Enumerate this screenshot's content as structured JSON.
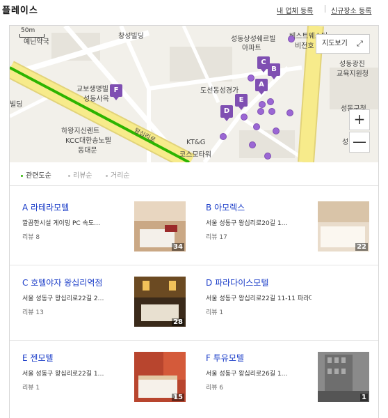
{
  "header": {
    "title": "플레이스",
    "link_register": "내 업체 등록",
    "link_new_place": "신규장소 등록"
  },
  "map": {
    "scale_label": "50m",
    "map_view_label": "지도보기",
    "zoom_in_label": "+",
    "zoom_out_label": "—",
    "road_label": "왕십리로",
    "labels": {
      "yeonlip": "예닌약국",
      "changseong": "창성빌딩",
      "seongdong_apt1": "성동상성쉐르빌",
      "seongdong_apt2": "아파트",
      "bestwestern": "베스트웨스턴",
      "bijeon": "비전호",
      "gyobo1": "교보생명빌",
      "gyobo2": "성동사옥",
      "doseon": "도선동성경가",
      "gwangjin1": "성동광진",
      "gwangjin2": "교육지원청",
      "guchung": "성동구청",
      "building": "빌딩",
      "hawang1": "하왕지신렌트",
      "hawang2": "KCC대한송노텔",
      "dongdaemun": "동대문",
      "ktg1": "KT&G",
      "ktg2": "코스모타워",
      "seong": "성"
    }
  },
  "sort": {
    "relevance": "관련도순",
    "review": "리뷰순",
    "distance": "거리순"
  },
  "places": [
    {
      "marker": "A",
      "name": "라테라모텔",
      "address": "깔끔한시설 게이밍 PC 속도…",
      "review": "리뷰 8",
      "photo_count": "34"
    },
    {
      "marker": "B",
      "name": "아모렉스",
      "address": "서울 성동구 왕십리로20길 1…",
      "review": "리뷰 17",
      "photo_count": "22"
    },
    {
      "marker": "C",
      "name": "호텔야자 왕십리역점",
      "address": "서울 성동구 왕십리로22길 2…",
      "review": "리뷰 13",
      "photo_count": "28"
    },
    {
      "marker": "D",
      "name": "파라다이스모텔",
      "address": "서울 성동구 왕십리로22길 11-11 파라다이스…",
      "review": "리뷰 1",
      "photo_count": ""
    },
    {
      "marker": "E",
      "name": "젠모텔",
      "address": "서울 성동구 왕십리로22길 1…",
      "review": "리뷰 1",
      "photo_count": "15"
    },
    {
      "marker": "F",
      "name": "투유모텔",
      "address": "서울 성동구 왕십리로26길 1…",
      "review": "리뷰 6",
      "photo_count": "1"
    }
  ],
  "colors": {
    "marker": "#7f4fb2",
    "link": "#1a3cc8",
    "subway_line": "#2db400",
    "main_road": "#f7eb8b"
  }
}
